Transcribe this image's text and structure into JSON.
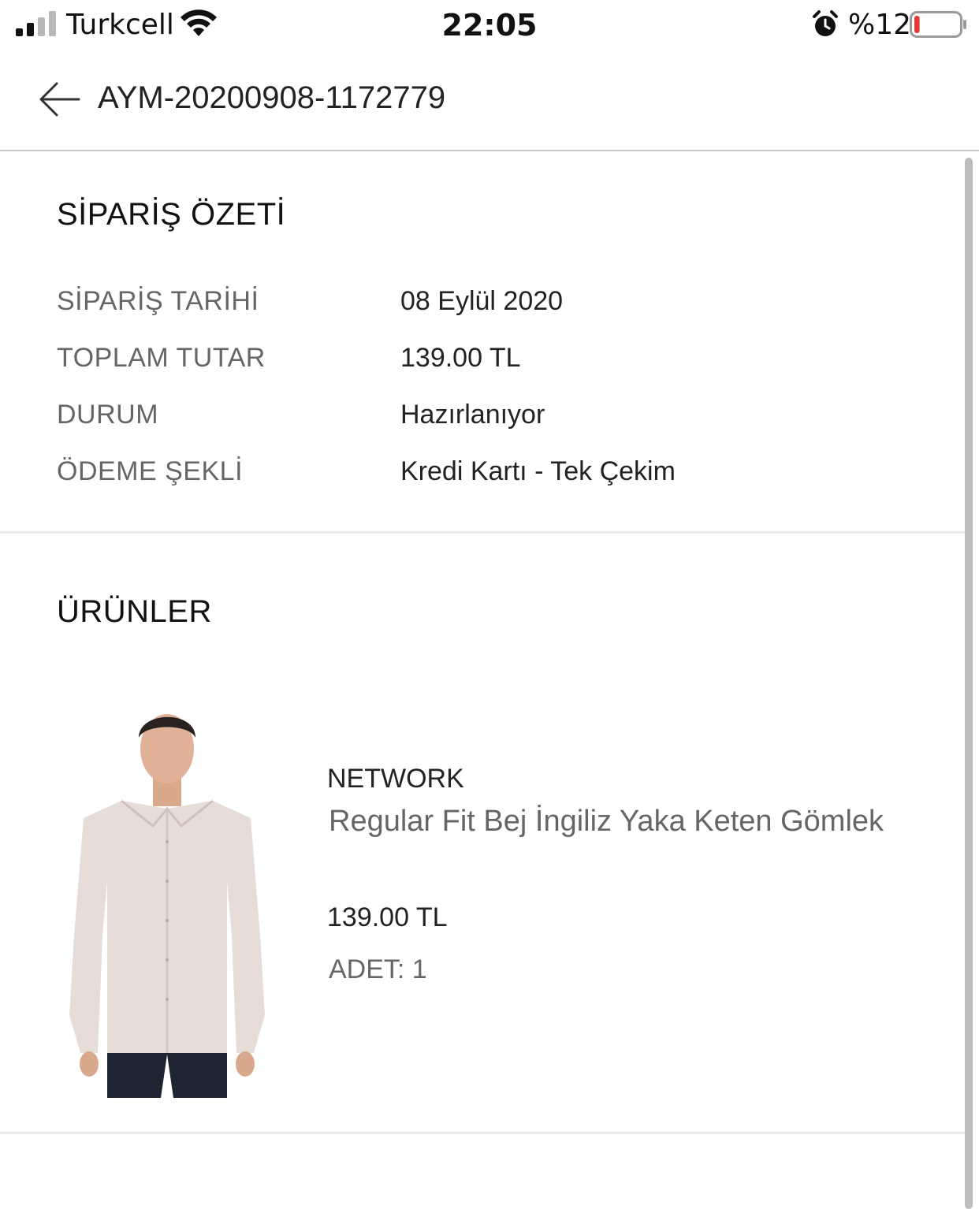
{
  "status_bar": {
    "carrier": "Turkcell",
    "time": "22:05",
    "battery_percent": "%12",
    "battery_level": 0.12,
    "battery_color": "#e53935",
    "signal_bars_active": 2,
    "signal_bars_total": 4
  },
  "header": {
    "back_icon": "arrow-left-icon",
    "order_number": "AYM-20200908-1172779"
  },
  "summary": {
    "title": "SİPARİŞ ÖZETİ",
    "rows": [
      {
        "label": "SİPARİŞ TARİHİ",
        "value": "08 Eylül 2020"
      },
      {
        "label": "TOPLAM TUTAR",
        "value": "139.00 TL"
      },
      {
        "label": "DURUM",
        "value": "Hazırlanıyor"
      },
      {
        "label": "ÖDEME ŞEKLİ",
        "value": "Kredi Kartı -  Tek Çekim"
      }
    ]
  },
  "products": {
    "title": "ÜRÜNLER",
    "items": [
      {
        "brand": "NETWORK",
        "name": "Regular Fit Bej İngiliz Yaka Keten Gömlek",
        "price": "139.00 TL",
        "quantity": "ADET: 1"
      }
    ]
  }
}
